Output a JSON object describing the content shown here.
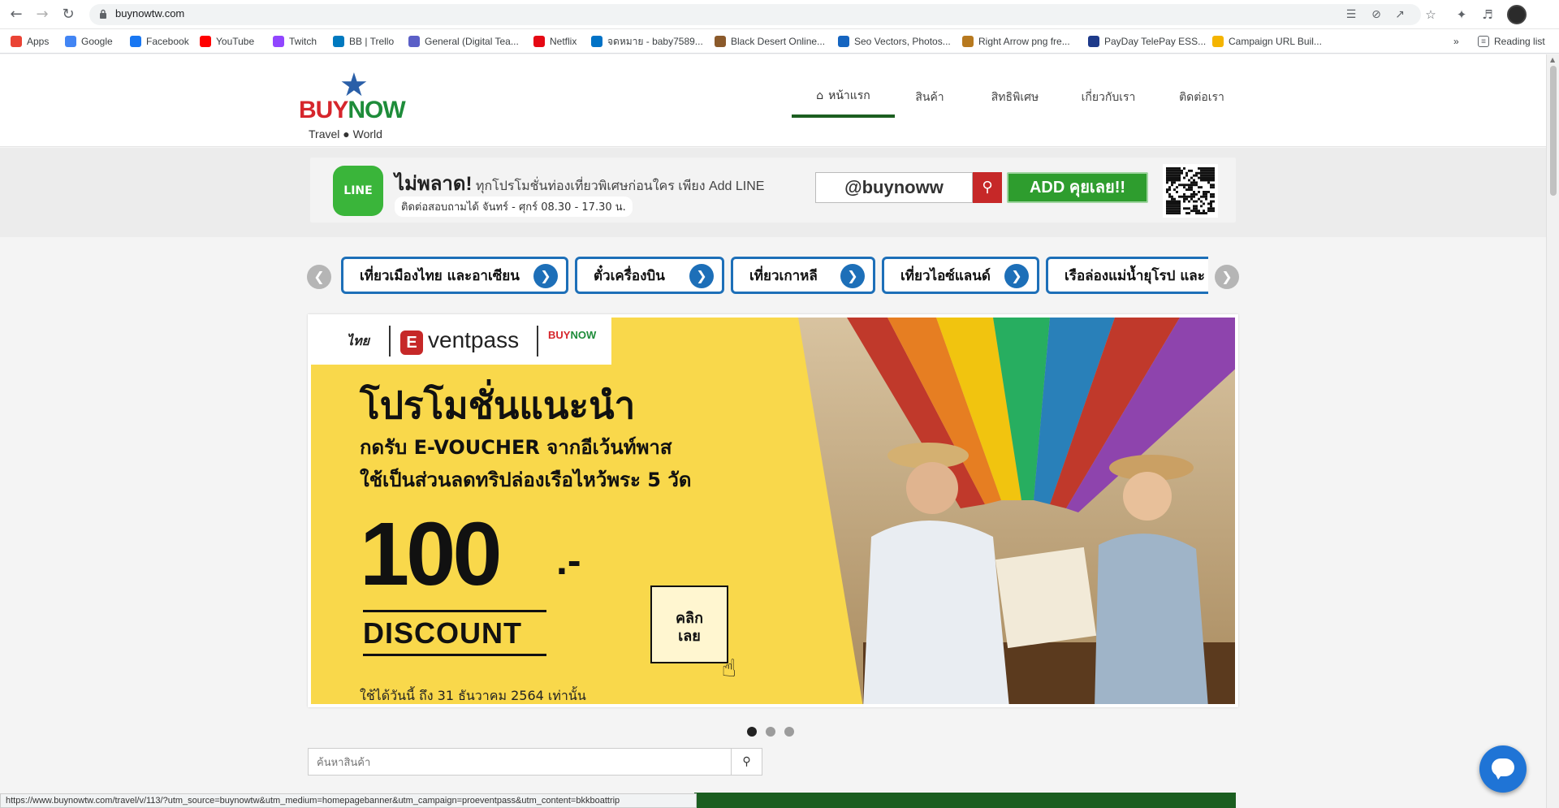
{
  "browser": {
    "url": "buynowtw.com",
    "reading_list": "Reading list",
    "bookmarks": [
      {
        "label": "Apps",
        "color": "#ea4335"
      },
      {
        "label": "Google",
        "color": "#4285f4"
      },
      {
        "label": "Facebook",
        "color": "#1877f2"
      },
      {
        "label": "YouTube",
        "color": "#ff0000"
      },
      {
        "label": "Twitch",
        "color": "#9146ff"
      },
      {
        "label": "BB | Trello",
        "color": "#0079bf"
      },
      {
        "label": "General (Digital Tea...",
        "color": "#5b5fc7"
      },
      {
        "label": "Netflix",
        "color": "#e50914"
      },
      {
        "label": "จดหมาย - baby7589...",
        "color": "#0072c6"
      },
      {
        "label": "Black Desert Online...",
        "color": "#8b5a2b"
      },
      {
        "label": "Seo Vectors, Photos...",
        "color": "#1565c0"
      },
      {
        "label": "Right Arrow png fre...",
        "color": "#b7791f"
      },
      {
        "label": "PayDay TelePay ESS...",
        "color": "#1e3a8a"
      },
      {
        "label": "Campaign URL Buil...",
        "color": "#f4b400"
      }
    ]
  },
  "site": {
    "logo": {
      "brand_a": "BUY",
      "brand_b": "NOW",
      "tagline": "Travel ● World"
    },
    "nav": [
      {
        "label": "หน้าแรก"
      },
      {
        "label": "สินค้า"
      },
      {
        "label": "สิทธิพิเศษ"
      },
      {
        "label": "เกี่ยวกับเรา"
      },
      {
        "label": "ติดต่อเรา"
      }
    ]
  },
  "line_banner": {
    "logo_text": "LINE",
    "headline": "ไม่พลาด!",
    "headline_rest": " ทุกโปรโมชั่นท่องเที่ยวพิเศษก่อนใคร เพียง Add LINE",
    "hours": "ติดต่อสอบถามได้ จันทร์ - ศุกร์ 08.30 - 17.30 น.",
    "line_id": "@buynoww",
    "add_button": "ADD คุยเลย!!"
  },
  "categories": [
    {
      "label": "เที่ยวเมืองไทย และอาเซียน"
    },
    {
      "label": "ตั๋วเครื่องบิน"
    },
    {
      "label": "เที่ยวเกาหลี"
    },
    {
      "label": "เที่ยวไอซ์แลนด์"
    },
    {
      "label": "เรือล่องแม่น้ำยุโรป และ เรือ"
    }
  ],
  "hero": {
    "partner_a": "ไทย",
    "partner_b": "ventpass",
    "partner_b_mark": "E",
    "partner_c_a": "BUY",
    "partner_c_b": "NOW",
    "title": "โปรโมชั่นแนะนำ",
    "sub1": "กดรับ E-VOUCHER จากอีเว้นท์พาส",
    "sub2": "ใช้เป็นส่วนลดทริปล่องเรือไหว้พระ 5 วัด",
    "amount": "100",
    "amount_suffix": ".-",
    "discount": "DISCOUNT",
    "click_line1": "คลิก",
    "click_line2": "เลย",
    "valid": "ใช้ได้วันนี้ ถึง 31 ธันวาคม 2564 เท่านั้น"
  },
  "search": {
    "placeholder": "ค้นหาสินค้า"
  },
  "status_url": "https://www.buynowtw.com/travel/v/113/?utm_source=buynowtw&utm_medium=homepagebanner&utm_campaign=proeventpass&utm_content=bkkboattrip",
  "colors": {
    "accent_green": "#1b5e20",
    "brand_red": "#d6262c",
    "pill_blue": "#1d6fb8",
    "hero_yellow": "#f9d84b"
  }
}
